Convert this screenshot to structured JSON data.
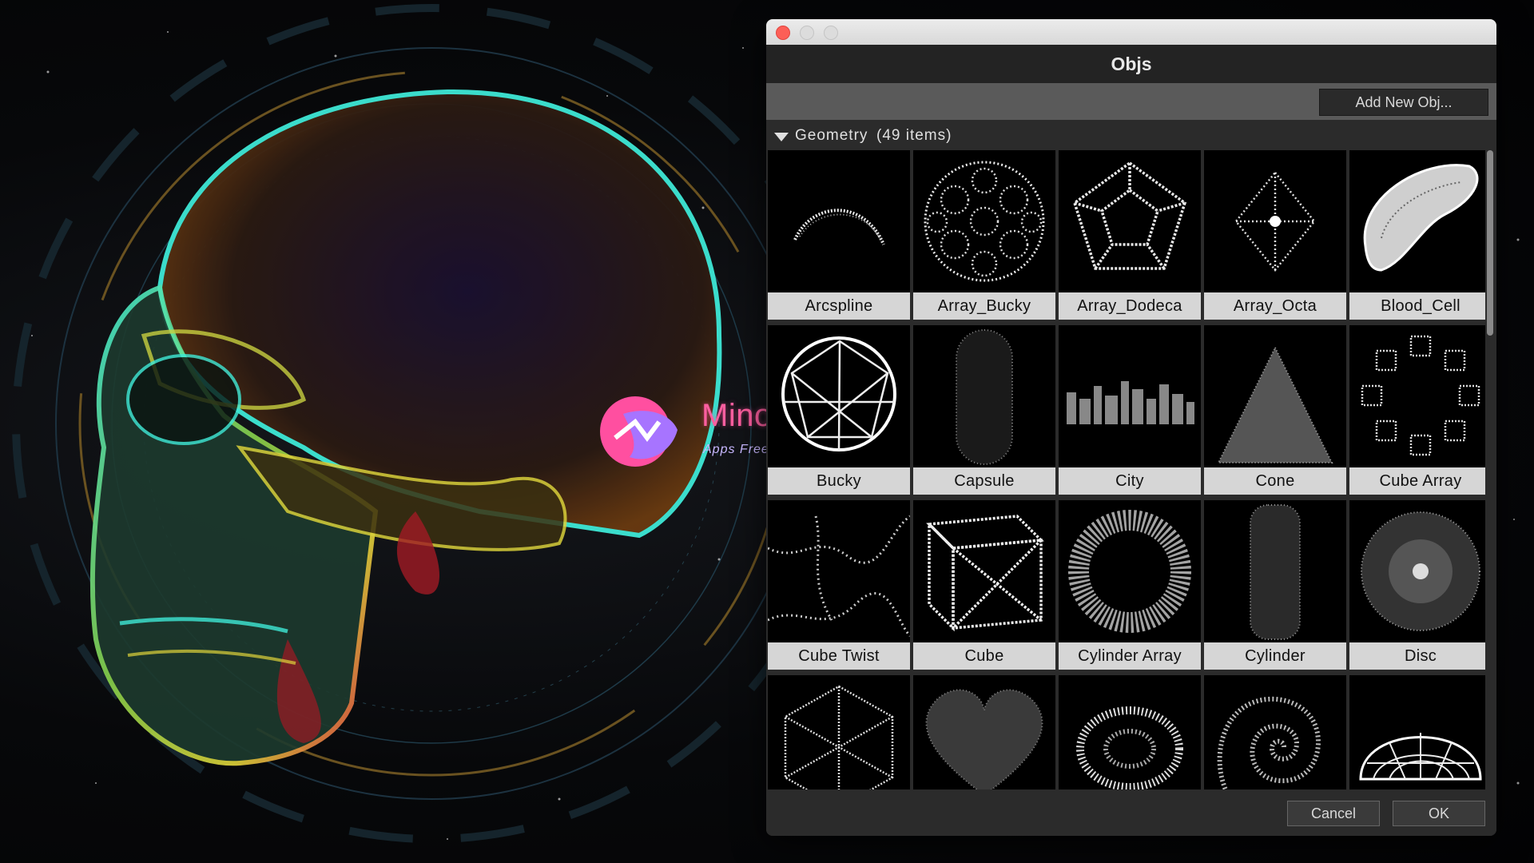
{
  "watermark": {
    "title": "MinorPatch.com",
    "subtitle": "Apps Free Download | Niche Solution"
  },
  "dialog": {
    "title": "Objs",
    "add_button": "Add New Obj...",
    "group": {
      "name": "Geometry",
      "count": "(49 items)"
    },
    "items": [
      {
        "label": "Arcspline",
        "icon": "arc-spline-icon"
      },
      {
        "label": "Array_Bucky",
        "icon": "array-bucky-icon"
      },
      {
        "label": "Array_Dodeca",
        "icon": "array-dodeca-icon"
      },
      {
        "label": "Array_Octa",
        "icon": "array-octa-icon"
      },
      {
        "label": "Blood_Cell",
        "icon": "blood-cell-icon"
      },
      {
        "label": "Bucky",
        "icon": "bucky-sphere-icon"
      },
      {
        "label": "Capsule",
        "icon": "capsule-icon"
      },
      {
        "label": "City",
        "icon": "city-icon"
      },
      {
        "label": "Cone",
        "icon": "cone-icon"
      },
      {
        "label": "Cube Array",
        "icon": "cube-array-icon"
      },
      {
        "label": "Cube Twist",
        "icon": "cube-twist-icon"
      },
      {
        "label": "Cube",
        "icon": "cube-icon"
      },
      {
        "label": "Cylinder Array",
        "icon": "cylinder-array-icon"
      },
      {
        "label": "Cylinder",
        "icon": "cylinder-icon"
      },
      {
        "label": "Disc",
        "icon": "disc-icon"
      },
      {
        "label": "",
        "icon": "dodecahedron-icon"
      },
      {
        "label": "",
        "icon": "heart-icon"
      },
      {
        "label": "",
        "icon": "particle-cloud-icon"
      },
      {
        "label": "",
        "icon": "spiral-icon"
      },
      {
        "label": "",
        "icon": "dome-icon"
      }
    ],
    "cancel_button": "Cancel",
    "ok_button": "OK"
  }
}
